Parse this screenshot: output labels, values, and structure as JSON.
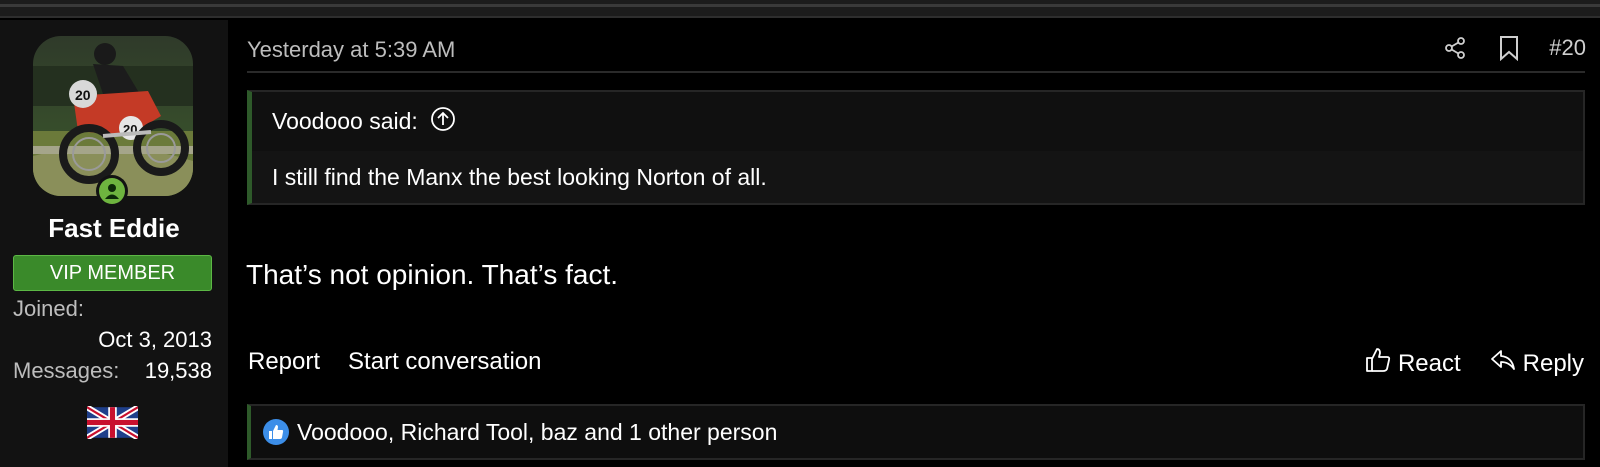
{
  "post": {
    "date": "Yesterday at 5:39 AM",
    "number": "#20",
    "quote": {
      "author_line": "Voodooo said:",
      "text": "I still find the Manx the best looking Norton of all."
    },
    "message": "That’s not opinion. That’s fact.",
    "footer": {
      "report": "Report",
      "start_conversation": "Start conversation",
      "react": "React",
      "reply": "Reply"
    },
    "reactions_text": "Voodooo, Richard Tool, baz and 1 other person"
  },
  "user": {
    "name": "Fast Eddie",
    "banner": "VIP MEMBER",
    "joined_label": "Joined:",
    "joined_value": "Oct 3, 2013",
    "messages_label": "Messages:",
    "messages_value": "19,538",
    "flag": "uk-flag-icon",
    "status": "online"
  },
  "colors": {
    "background": "#000000",
    "user_cell": "#121212",
    "vip_banner": "#3a8a2a",
    "online": "#6eb43f",
    "like": "#3c8ee8",
    "quote_accent": "#2e5a2a"
  }
}
